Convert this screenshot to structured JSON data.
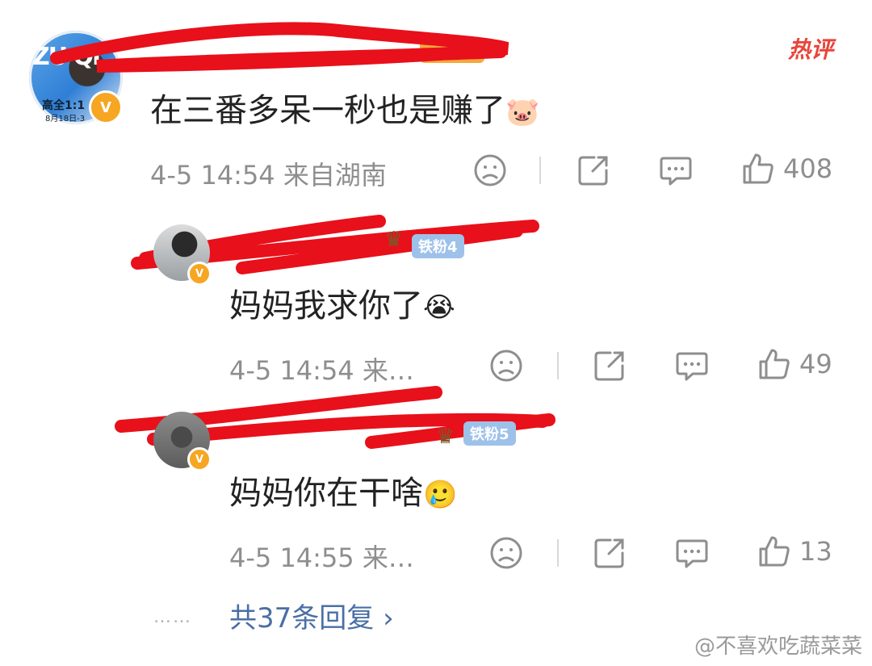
{
  "hot_label": "热评",
  "comments": [
    {
      "avatar_text": "ZU QI",
      "avatar_sub": "高全1:1",
      "avatar_sub2": "8月18日-3",
      "content": "在三番多呆一秒也是赚了",
      "emoji": "🐷",
      "time": "4-5 14:54",
      "location": "来自湖南",
      "likes": "408"
    },
    {
      "content": "妈妈我求你了",
      "emoji": "😭",
      "time": "4-5 14:54",
      "location": "来…",
      "fan_badge": "铁粉4",
      "likes": "49"
    },
    {
      "content": "妈妈你在干啥",
      "emoji": "🥲",
      "time": "4-5 14:55",
      "location": "来…",
      "fan_badge": "铁粉5",
      "likes": "13"
    }
  ],
  "more_replies": "共37条回复",
  "more_chevron": "›",
  "more_dots": "……",
  "watermark": "@不喜欢吃蔬菜菜",
  "verified_mark": "V",
  "icons": {
    "dislike": "sad-face-icon",
    "share": "share-icon",
    "comment": "comment-bubble-icon",
    "like": "thumbs-up-icon"
  },
  "colors": {
    "username": "#f08a1a",
    "link": "#4a6fa5",
    "meta": "#8e8e8e",
    "hot": "#e8453a",
    "redaction": "#e8101a"
  }
}
